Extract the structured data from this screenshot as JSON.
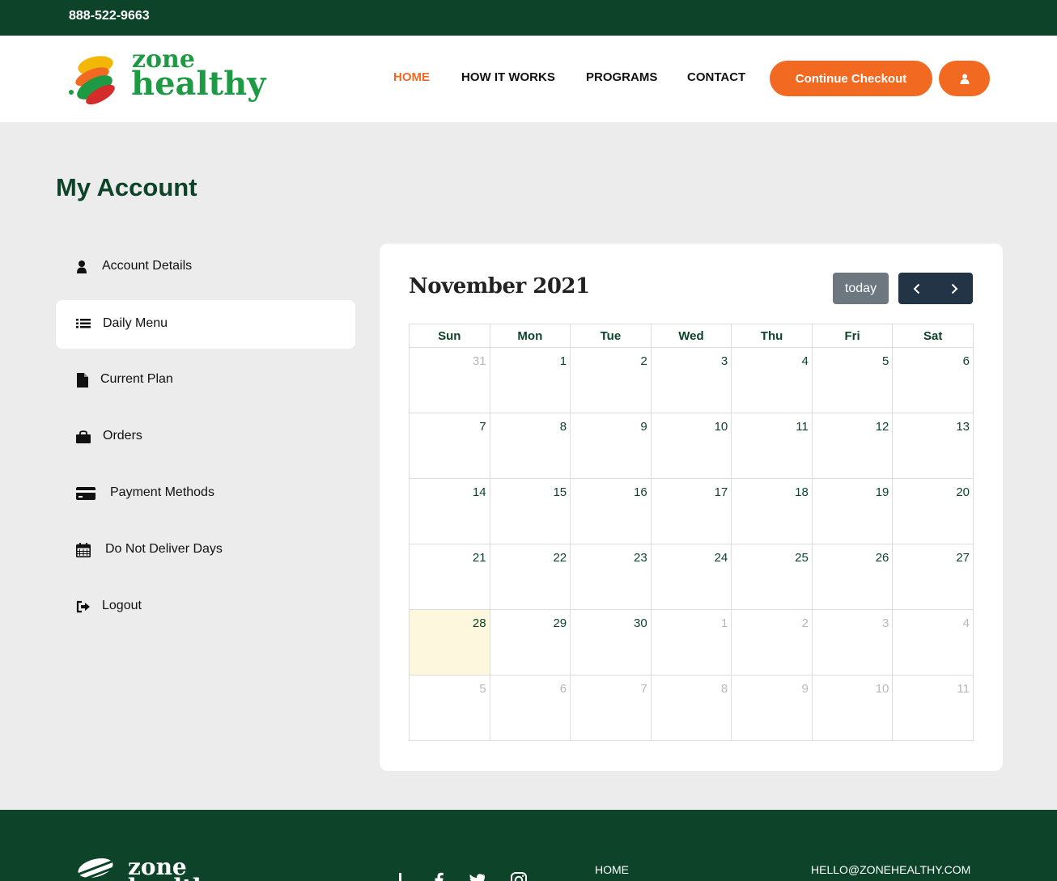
{
  "topbar": {
    "phone": "888-522-9663"
  },
  "brand": {
    "line1": "zone",
    "line2": "healthy",
    "colors": {
      "green": "#1f9a44",
      "yellow": "#f2b705",
      "orange": "#f26a22",
      "red": "#d62b2b"
    }
  },
  "nav": {
    "items": [
      {
        "label": "HOME",
        "active": true
      },
      {
        "label": "HOW IT WORKS",
        "active": false
      },
      {
        "label": "PROGRAMS",
        "active": false
      },
      {
        "label": "CONTACT",
        "active": false
      }
    ],
    "checkout_label": "Continue Checkout",
    "user_icon": "user-icon"
  },
  "page": {
    "title": "My Account"
  },
  "sidebar": {
    "items": [
      {
        "label": "Account Details",
        "icon": "user-icon",
        "active": false
      },
      {
        "label": "Daily Menu",
        "icon": "list-icon",
        "active": true
      },
      {
        "label": "Current Plan",
        "icon": "file-icon",
        "active": false
      },
      {
        "label": "Orders",
        "icon": "shopping-bag-icon",
        "active": false
      },
      {
        "label": "Payment Methods",
        "icon": "credit-card-icon",
        "active": false
      },
      {
        "label": "Do Not Deliver Days",
        "icon": "calendar-icon",
        "active": false
      },
      {
        "label": "Logout",
        "icon": "sign-out-icon",
        "active": false
      }
    ]
  },
  "calendar": {
    "title": "November 2021",
    "today_label": "today",
    "prev_icon": "chevron-left-icon",
    "next_icon": "chevron-right-icon",
    "weekdays": [
      "Sun",
      "Mon",
      "Tue",
      "Wed",
      "Thu",
      "Fri",
      "Sat"
    ],
    "weeks": [
      [
        "31",
        "1",
        "2",
        "3",
        "4",
        "5",
        "6"
      ],
      [
        "7",
        "8",
        "9",
        "10",
        "11",
        "12",
        "13"
      ],
      [
        "14",
        "15",
        "16",
        "17",
        "18",
        "19",
        "20"
      ],
      [
        "21",
        "22",
        "23",
        "24",
        "25",
        "26",
        "27"
      ],
      [
        "28",
        "29",
        "30",
        "1",
        "2",
        "3",
        "4"
      ],
      [
        "5",
        "6",
        "7",
        "8",
        "9",
        "10",
        "11"
      ]
    ],
    "today_color": "#fcf7dd"
  },
  "footer": {
    "brand_line1": "zone",
    "brand_line2": "healthy",
    "social_icons": [
      "yelp-icon",
      "facebook-icon",
      "twitter-icon",
      "instagram-icon"
    ],
    "links": [
      "HOME"
    ],
    "email": "HELLO@ZONEHEALTHY.COM"
  }
}
